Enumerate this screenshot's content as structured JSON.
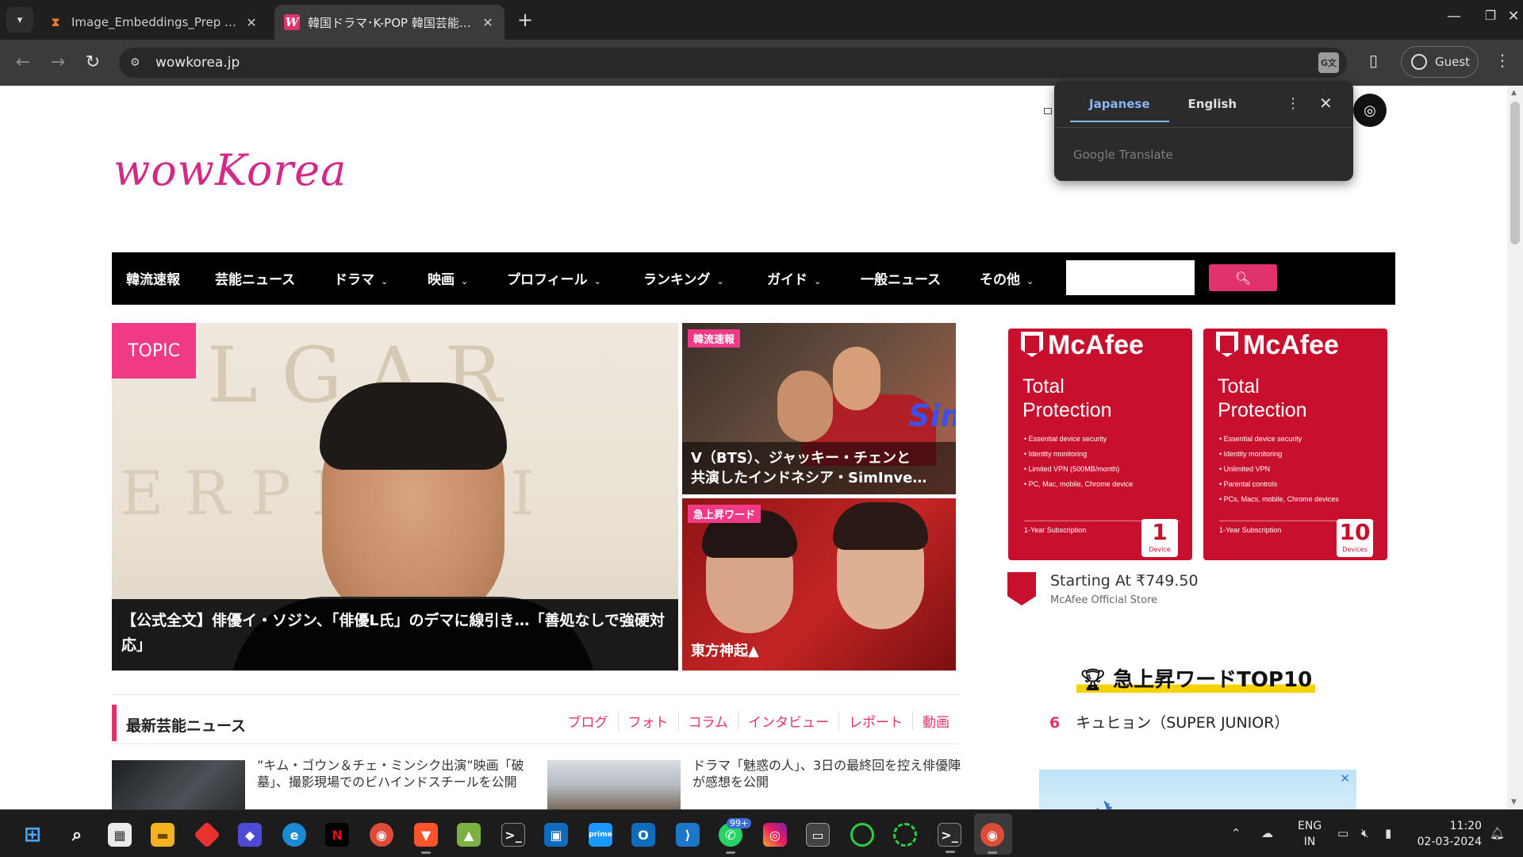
{
  "browser": {
    "tabs": [
      {
        "title": "Image_Embeddings_Prep - Jupyter",
        "active": false,
        "favicon": "hourglass-icon"
      },
      {
        "title": "韓国ドラマ･K-POP 韓国芸能ならwowKorea",
        "active": true,
        "favicon": "w-icon"
      }
    ],
    "url": "wowkorea.jp",
    "profile_label": "Guest"
  },
  "translate_popup": {
    "tab_source": "Japanese",
    "tab_target": "English",
    "brand": "Google Translate"
  },
  "site": {
    "logo": "wowKorea",
    "nav": [
      {
        "label": "韓流速報",
        "dropdown": false
      },
      {
        "label": "芸能ニュース",
        "dropdown": false
      },
      {
        "label": "ドラマ",
        "dropdown": true
      },
      {
        "label": "映画",
        "dropdown": true
      },
      {
        "label": "プロフィール",
        "dropdown": true
      },
      {
        "label": "ランキング",
        "dropdown": true
      },
      {
        "label": "ガイド",
        "dropdown": true
      },
      {
        "label": "一般ニュース",
        "dropdown": false
      },
      {
        "label": "その他",
        "dropdown": true
      }
    ],
    "search_placeholder": ""
  },
  "hero": {
    "tag": "TOPIC",
    "caption": "【公式全文】俳優イ・ソジン、「俳優L氏」のデマに線引き…「善処なしで強硬対応」"
  },
  "side_cards": [
    {
      "label": "韓流速報",
      "caption_line1": "V（BTS）、ジャッキー・チェンと",
      "caption_line2": "共演したインドネシア・SimInve…"
    },
    {
      "label": "急上昇ワード",
      "caption_line1": "東方神起▲",
      "caption_line2": ""
    }
  ],
  "ad": {
    "cards": [
      {
        "brand": "McAfee",
        "product_line1": "Total",
        "product_line2": "Protection",
        "features": [
          "Essential device security",
          "Identity monitoring",
          "Limited VPN (500MB/month)",
          "PC, Mac, mobile, Chrome device"
        ],
        "subscription": "1-Year Subscription",
        "devices": "1",
        "devices_label": "Device"
      },
      {
        "brand": "McAfee",
        "product_line1": "Total",
        "product_line2": "Protection",
        "features": [
          "Essential device security",
          "Identity monitoring",
          "Unlimited VPN",
          "Parental controls",
          "PCs, Macs, mobile, Chrome devices"
        ],
        "subscription": "1-Year Subscription",
        "devices": "10",
        "devices_label": "Devices"
      }
    ],
    "price": "Starting At ₹749.50",
    "store": "McAfee Official Store"
  },
  "trending": {
    "title": "急上昇ワードTOP10",
    "rows": [
      {
        "rank": "6",
        "text": "キュヒョン（SUPER JUNIOR）"
      }
    ]
  },
  "news_section": {
    "title": "最新芸能ニュース",
    "links": [
      "ブログ",
      "フォト",
      "コラム",
      "インタビュー",
      "レポート",
      "動画"
    ],
    "items": [
      {
        "text": "”キム・ゴウン＆チェ・ミンシク出演”映画「破墓」、撮影現場でのビハインドスチールを公開"
      },
      {
        "text": "ドラマ「魅惑の人」、3日の最終回を控え俳優陣が感想を公開"
      }
    ]
  },
  "taskbar": {
    "lang_line1": "ENG",
    "lang_line2": "IN",
    "time": "11:20",
    "date": "02-03-2024",
    "whatsapp_badge": "99+"
  },
  "colors": {
    "brand_pink": "#e0326f",
    "logo_pink": "#d42a87",
    "mcafee_red": "#c8102e",
    "translate_accent": "#8ab4f8"
  }
}
